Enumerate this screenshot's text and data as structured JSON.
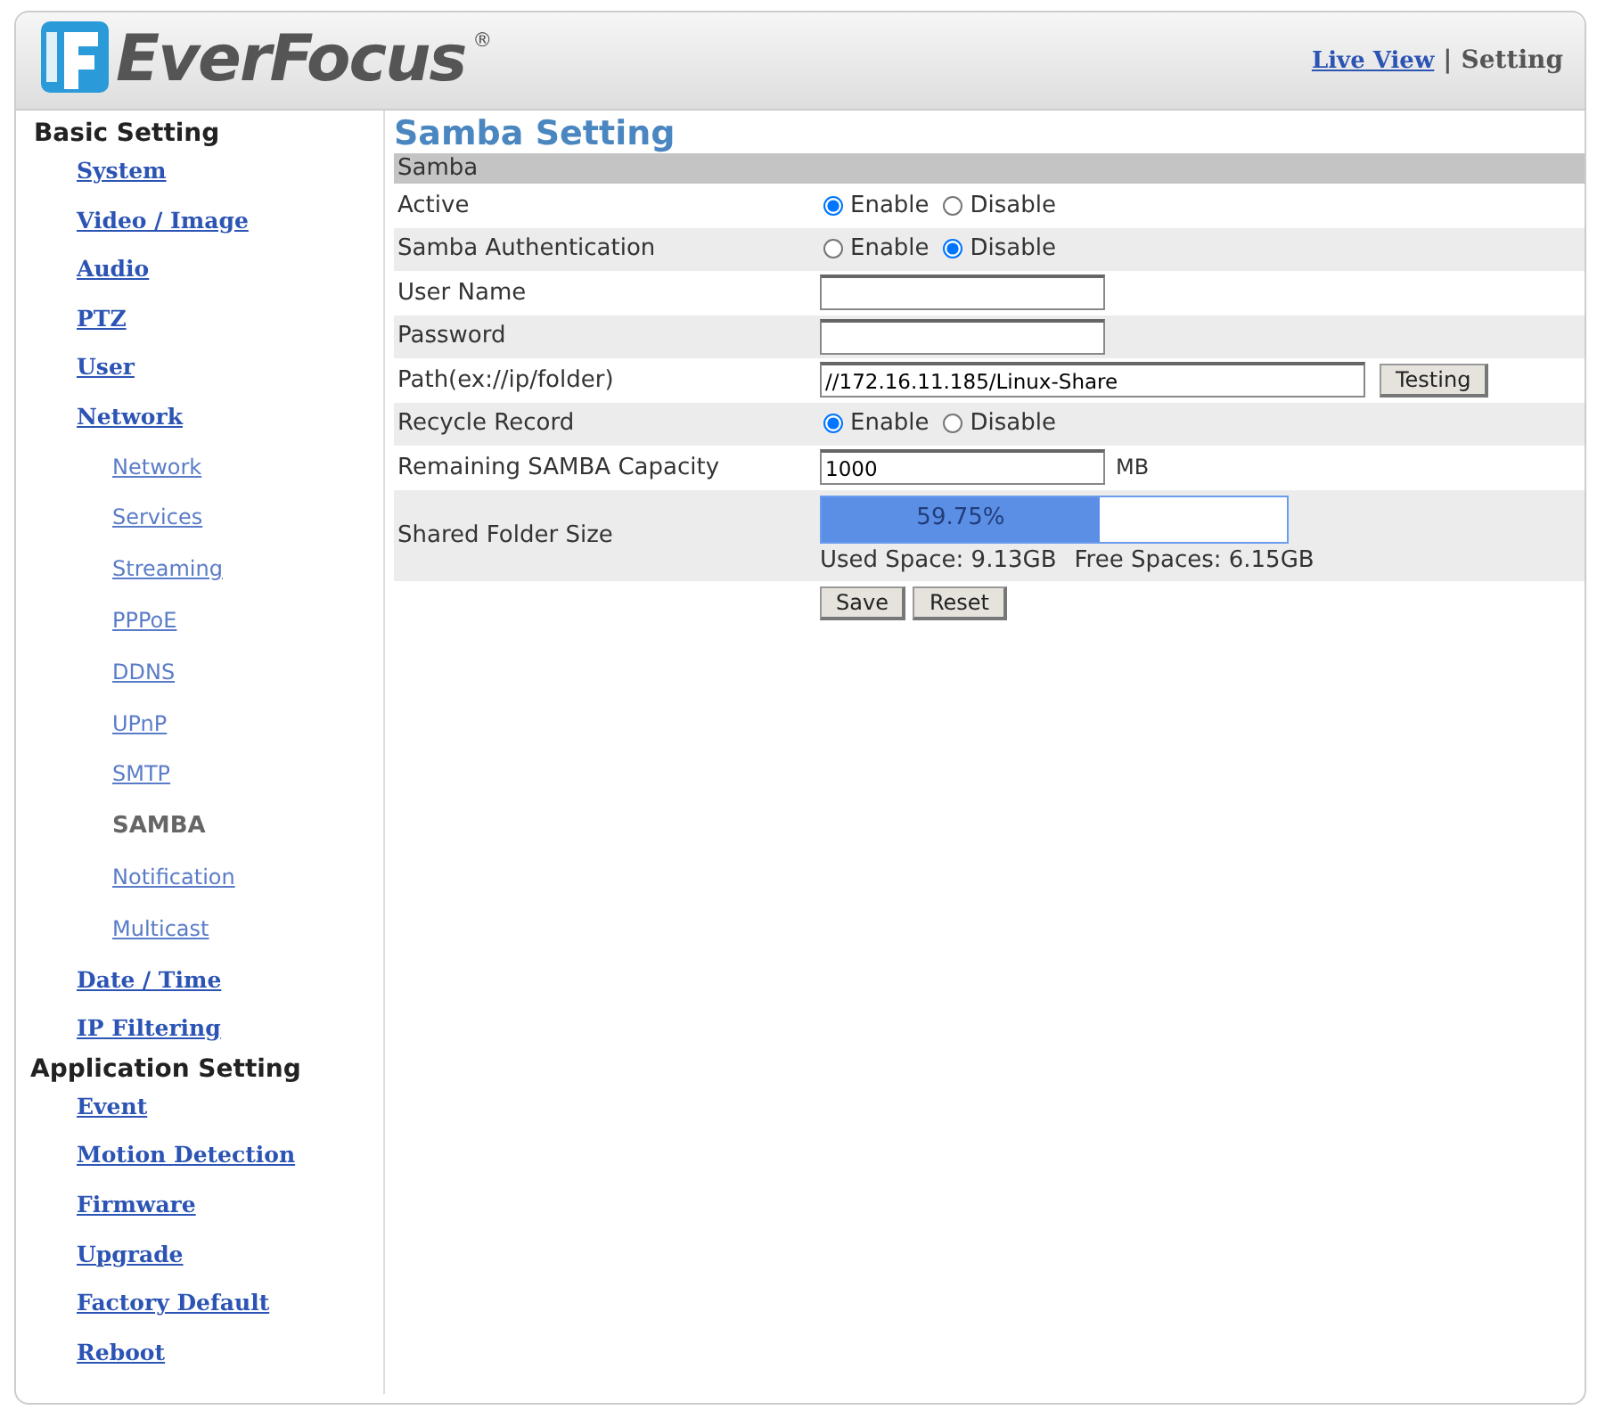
{
  "header": {
    "logo_text": "EverFocus",
    "logo_mark": "®",
    "separator": "|",
    "nav": [
      {
        "label": "Live View",
        "selected": false
      },
      {
        "label": "Setting",
        "selected": true
      }
    ]
  },
  "sidebar": [
    {
      "heading": "Basic Setting",
      "items": [
        {
          "label": "System",
          "selected": false
        },
        {
          "label": "Video / Image",
          "selected": false
        },
        {
          "label": "Audio",
          "selected": false
        },
        {
          "label": "PTZ",
          "selected": false
        },
        {
          "label": "User",
          "selected": false
        },
        {
          "label": "Network",
          "selected": false,
          "children": [
            {
              "label": "Network",
              "selected": false
            },
            {
              "label": "Services",
              "selected": false
            },
            {
              "label": "Streaming",
              "selected": false
            },
            {
              "label": "PPPoE",
              "selected": false
            },
            {
              "label": "DDNS",
              "selected": false
            },
            {
              "label": "UPnP",
              "selected": false
            },
            {
              "label": "SMTP",
              "selected": false
            },
            {
              "label": "SAMBA",
              "selected": true
            },
            {
              "label": "Notification",
              "selected": false
            },
            {
              "label": "Multicast",
              "selected": false
            }
          ]
        },
        {
          "label": "Date / Time",
          "selected": false
        },
        {
          "label": "IP Filtering",
          "selected": false
        }
      ]
    },
    {
      "heading": "Application Setting",
      "items": [
        {
          "label": "Event",
          "selected": false
        },
        {
          "label": "Motion Detection",
          "selected": false
        },
        {
          "label": "Firmware",
          "selected": false
        },
        {
          "label": "Upgrade",
          "selected": false
        },
        {
          "label": "Factory Default",
          "selected": false
        },
        {
          "label": "Reboot",
          "selected": false
        }
      ]
    }
  ],
  "page_title": "Samba Setting",
  "section": "Samba",
  "rows": [
    {
      "kind": "radio",
      "label": "Active",
      "options": [
        {
          "label": "Enable",
          "selected": true
        },
        {
          "label": "Disable",
          "selected": false
        }
      ]
    },
    {
      "kind": "radio",
      "label": "Samba Authentication",
      "options": [
        {
          "label": "Enable",
          "selected": false
        },
        {
          "label": "Disable",
          "selected": true
        }
      ]
    },
    {
      "kind": "text",
      "label": "User Name"
    },
    {
      "kind": "text",
      "label": "Password"
    },
    {
      "kind": "path",
      "label": "Path(ex://ip/folder)",
      "value": "//172.16.11.185/Linux-Share",
      "button": "Testing"
    },
    {
      "kind": "radio",
      "label": "Recycle Record",
      "options": [
        {
          "label": "Enable",
          "selected": true
        },
        {
          "label": "Disable",
          "selected": false
        }
      ]
    },
    {
      "kind": "capacity",
      "label": "Remaining SAMBA Capacity",
      "value": "1000",
      "unit": "MB"
    },
    {
      "kind": "progress",
      "label": "Shared Folder Size",
      "level": 0.5975,
      "reading": "59.75%",
      "used": "Used Space: 9.13GB",
      "free": "Free Spaces: 6.15GB"
    }
  ],
  "buttons": [
    "Save",
    "Reset"
  ]
}
